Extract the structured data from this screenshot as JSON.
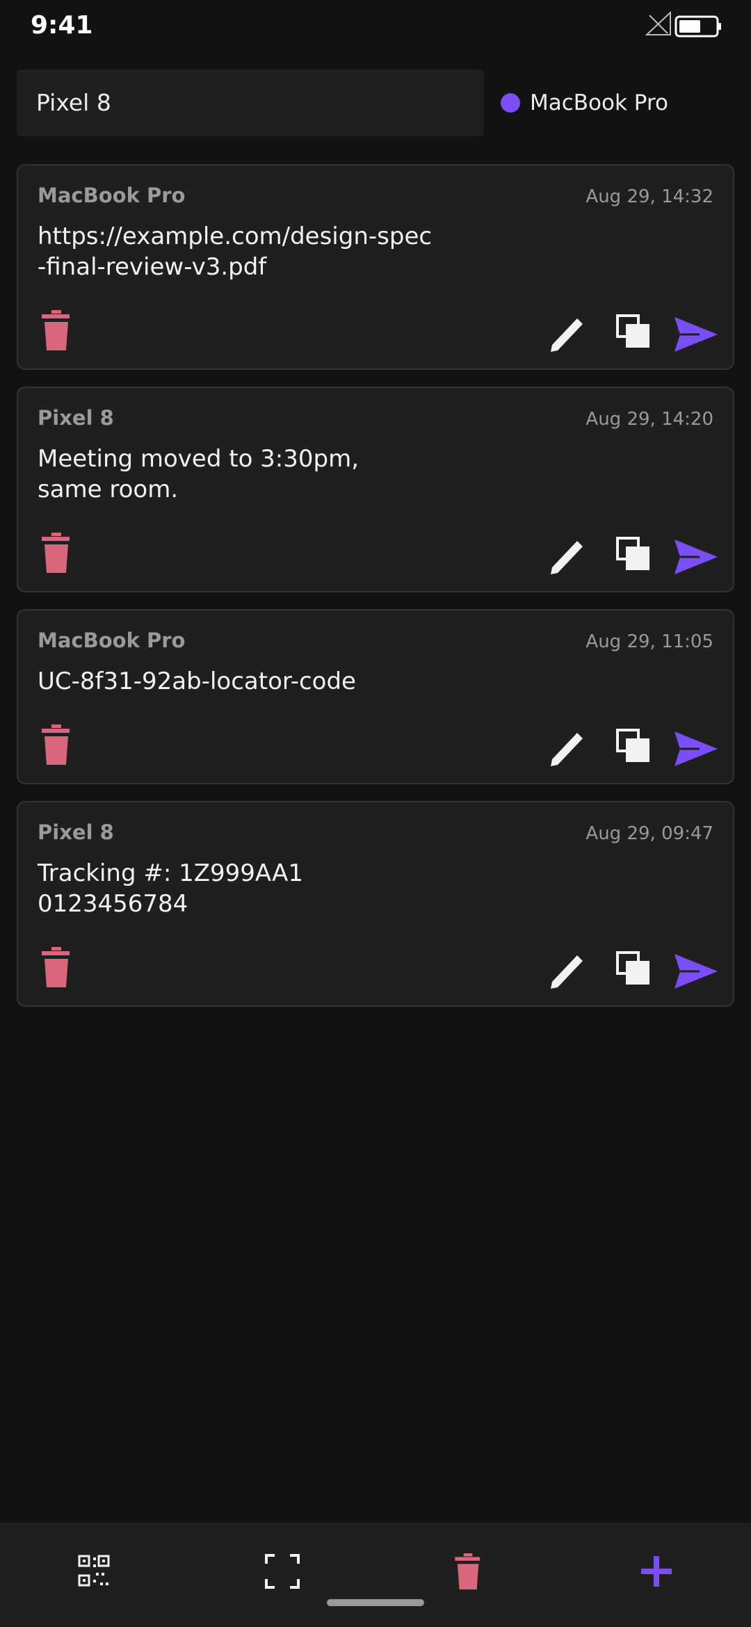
{
  "status": {
    "time": "9:41"
  },
  "header": {
    "device_name": "Pixel 8",
    "target_device": "MacBook Pro"
  },
  "clips": [
    {
      "device": "MacBook Pro",
      "time": "Aug 29, 14:32",
      "text": "https://example.com/design-spec\n-final-review-v3.pdf"
    },
    {
      "device": "Pixel 8",
      "time": "Aug 29, 14:20",
      "text": "Meeting moved to 3:30pm,\nsame room."
    },
    {
      "device": "MacBook Pro",
      "time": "Aug 29, 11:05",
      "text": "UC-8f31-92ab-locator-code"
    },
    {
      "device": "Pixel 8",
      "time": "Aug 29, 09:47",
      "text": "Tracking #: 1Z999AA1\n0123456784"
    }
  ],
  "colors": {
    "accent": "#7a4df5",
    "danger": "#d9667a",
    "card_bg": "#1f1f1f",
    "background": "#121212"
  },
  "icons": {
    "card_actions": [
      "trash-icon",
      "pencil-icon",
      "copy-icon",
      "send-icon"
    ],
    "bottom_bar": [
      "qr-code-icon",
      "scan-frame-icon",
      "trash-icon",
      "plus-icon"
    ]
  }
}
